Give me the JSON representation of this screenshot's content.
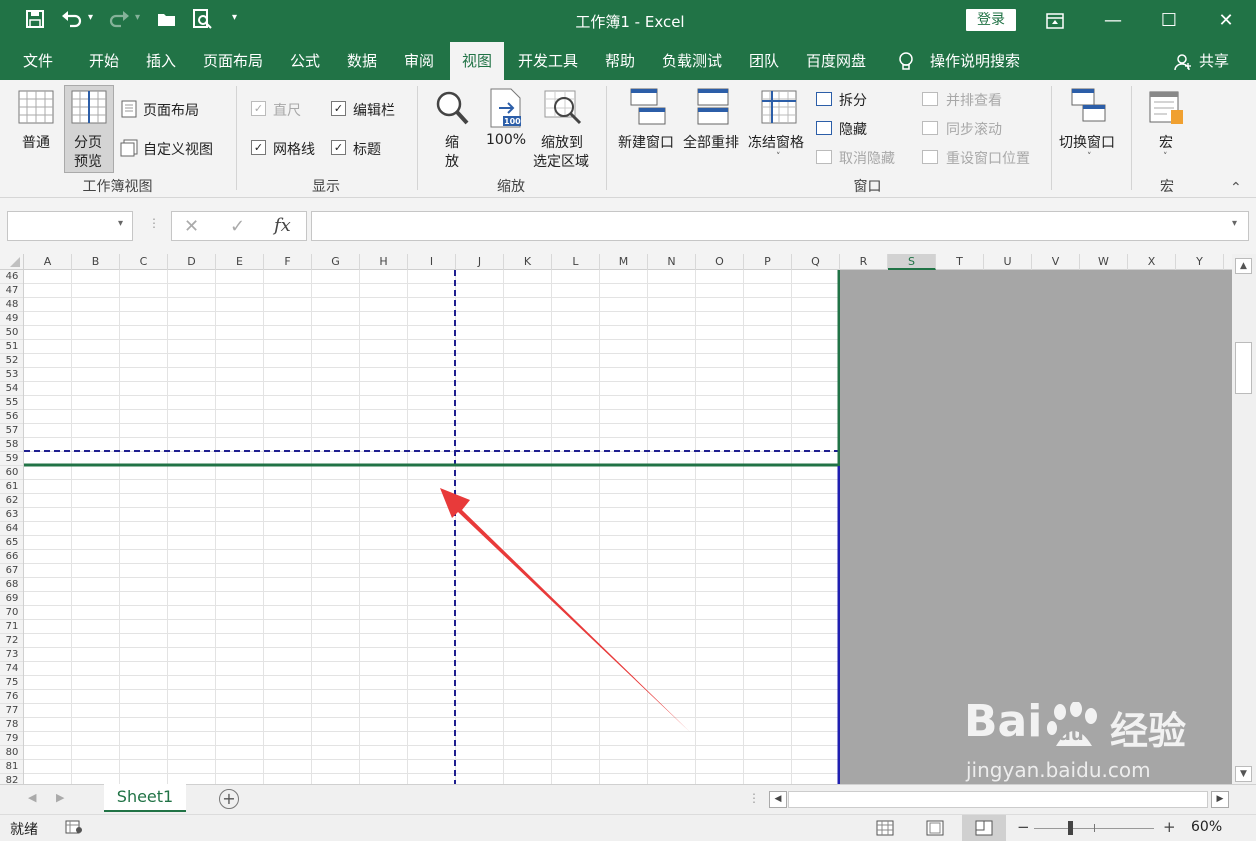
{
  "window": {
    "title": "工作簿1  -  Excel",
    "login_label": "登录"
  },
  "tabs": [
    {
      "label": "文件"
    },
    {
      "label": "开始"
    },
    {
      "label": "插入"
    },
    {
      "label": "页面布局"
    },
    {
      "label": "公式"
    },
    {
      "label": "数据"
    },
    {
      "label": "审阅"
    },
    {
      "label": "视图"
    },
    {
      "label": "开发工具"
    },
    {
      "label": "帮助"
    },
    {
      "label": "负载测试"
    },
    {
      "label": "团队"
    },
    {
      "label": "百度网盘"
    },
    {
      "label": "操作说明搜索"
    },
    {
      "label": "共享"
    }
  ],
  "ribbon": {
    "workbook_views": {
      "group_label": "工作簿视图",
      "normal": "普通",
      "page_break_line1": "分页",
      "page_break_line2": "预览",
      "page_layout": "页面布局",
      "custom_views": "自定义视图"
    },
    "show": {
      "group_label": "显示",
      "ruler": "直尺",
      "formula_bar": "编辑栏",
      "gridlines": "网格线",
      "headings": "标题"
    },
    "zoom": {
      "group_label": "缩放",
      "zoom_line1": "缩",
      "zoom_line2": "放",
      "hundred": "100%",
      "icon_badge": "100",
      "zoom_sel_line1": "缩放到",
      "zoom_sel_line2": "选定区域"
    },
    "window": {
      "group_label": "窗口",
      "new_window": "新建窗口",
      "arrange_all": "全部重排",
      "freeze_panes": "冻结窗格",
      "split": "拆分",
      "hide": "隐藏",
      "unhide": "取消隐藏",
      "side_by_side": "并排查看",
      "sync_scroll": "同步滚动",
      "reset_position": "重设窗口位置",
      "switch_windows": "切换窗口"
    },
    "macros": {
      "group_label": "宏",
      "macros": "宏"
    }
  },
  "formula_bar": {
    "fx": "fx",
    "name_box_value": "",
    "formula_value": ""
  },
  "columns": [
    "A",
    "B",
    "C",
    "D",
    "E",
    "F",
    "G",
    "H",
    "I",
    "J",
    "K",
    "L",
    "M",
    "N",
    "O",
    "P",
    "Q",
    "R",
    "S",
    "T",
    "U",
    "V",
    "W",
    "X",
    "Y"
  ],
  "rows": [
    "46",
    "47",
    "48",
    "49",
    "50",
    "51",
    "52",
    "53",
    "54",
    "55",
    "56",
    "57",
    "58",
    "59",
    "60",
    "61",
    "62",
    "63",
    "64",
    "65",
    "66",
    "67",
    "68",
    "69",
    "70",
    "71",
    "72",
    "73",
    "74",
    "75",
    "76",
    "77",
    "78",
    "79",
    "80",
    "81",
    "82"
  ],
  "sheet_tab": "Sheet1",
  "status": {
    "ready": "就绪",
    "zoom_level": "60%",
    "zoom_minus": "−",
    "zoom_plus": "+"
  },
  "watermark": {
    "text": "jingyan.baidu.com",
    "brand": "Bai",
    "brand2": "du",
    "brand3": "经验"
  },
  "colors": {
    "accent": "#217346",
    "page_break": "#1f1f8f",
    "arrow": "#e83a3a",
    "gray_area": "#a6a6a6"
  }
}
